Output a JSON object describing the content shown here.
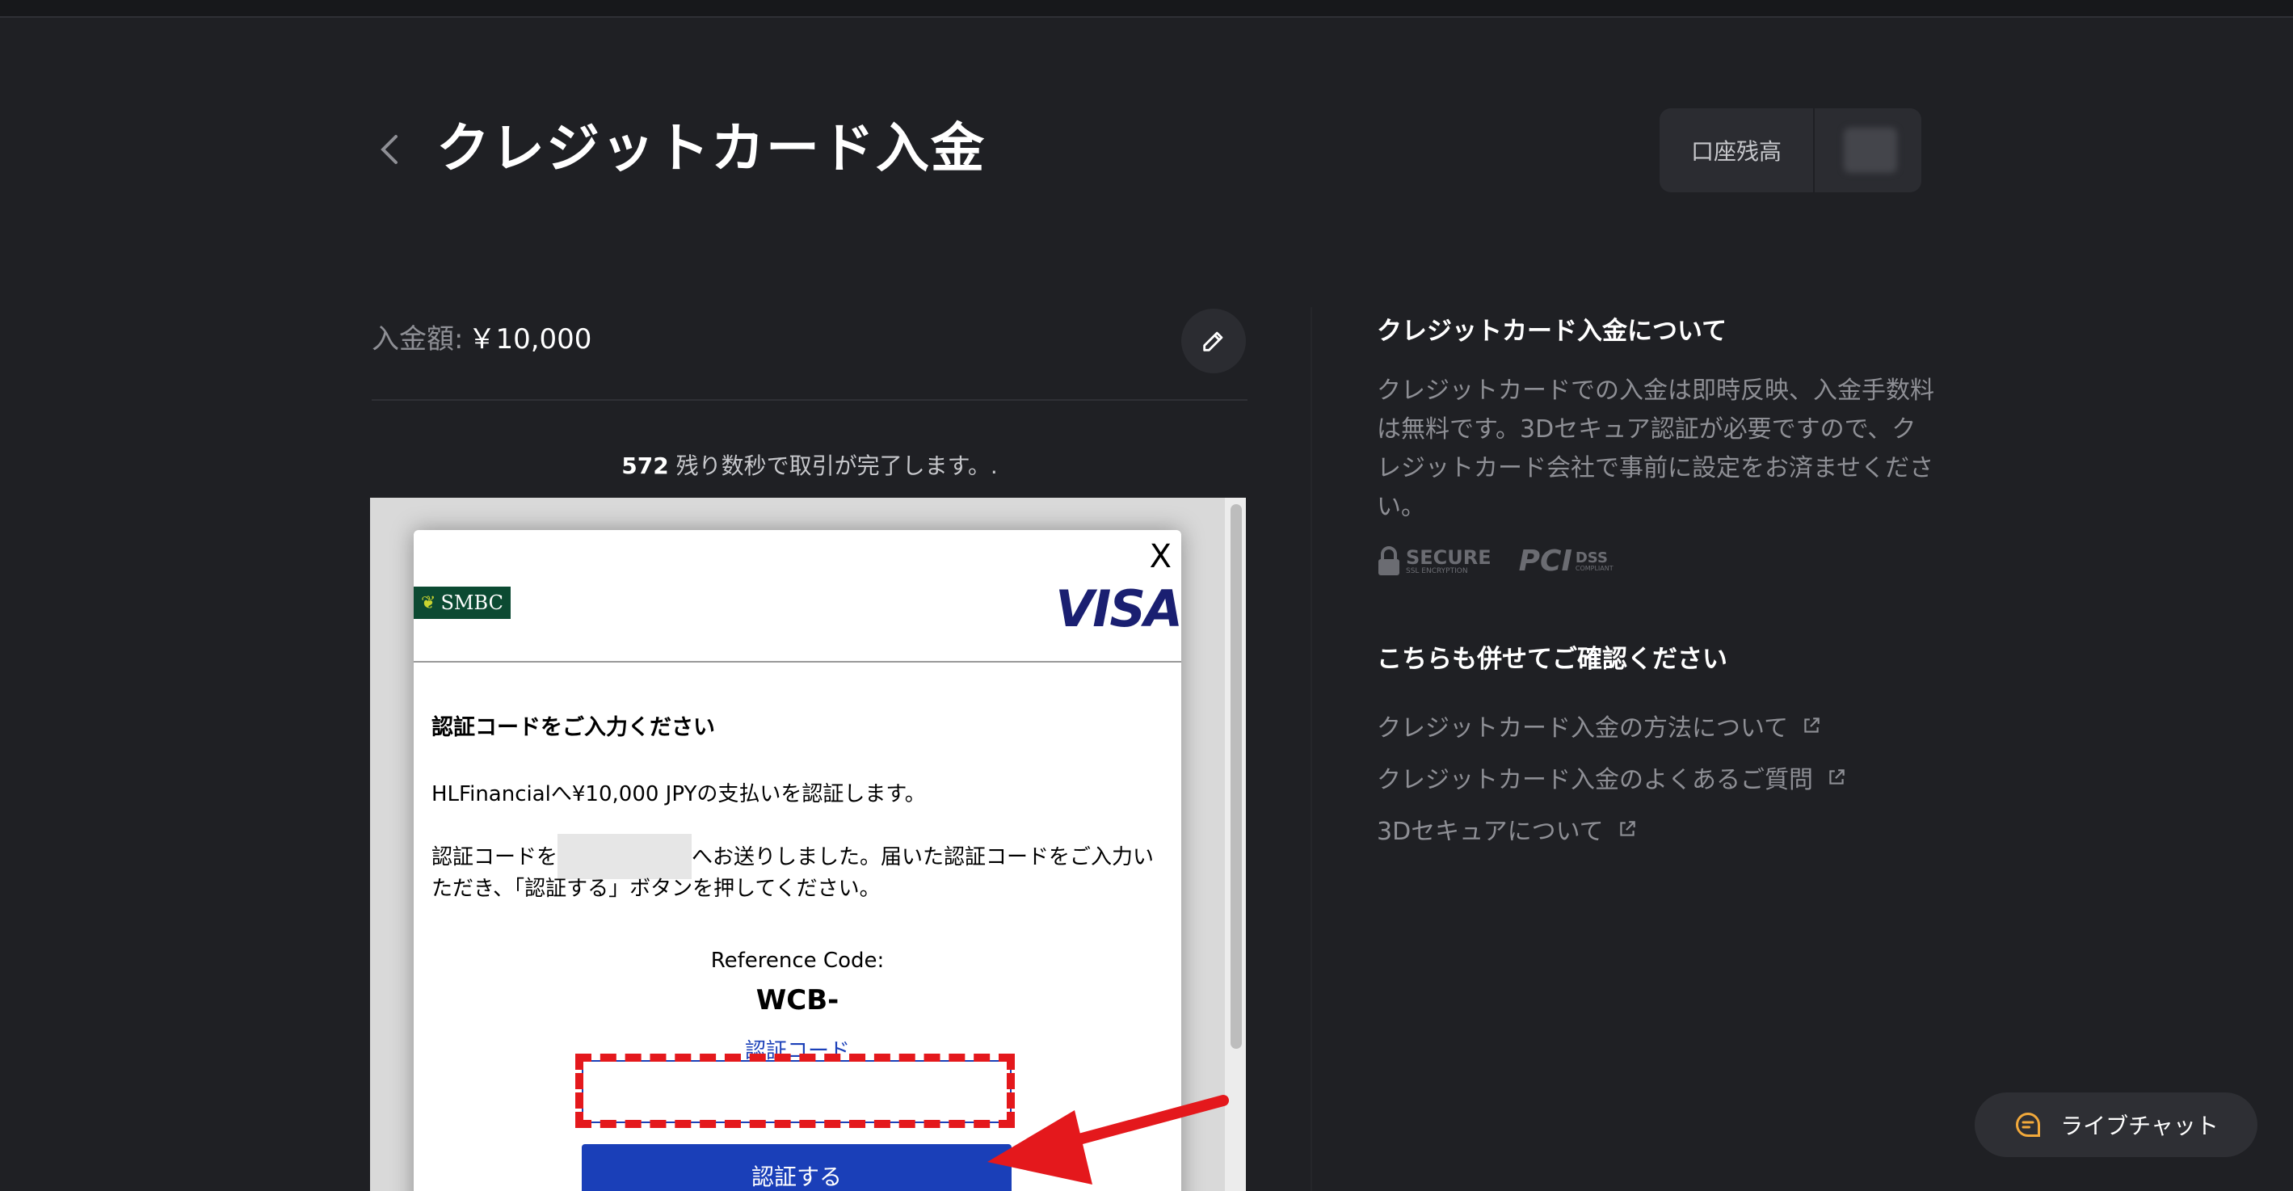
{
  "header": {
    "title": "クレジットカード入金",
    "balance_label": "口座残高"
  },
  "deposit": {
    "amount_label": "入金額:",
    "amount_value": "￥10,000",
    "countdown_seconds": "572",
    "countdown_text": " 残り数秒で取引が完了します。."
  },
  "auth_modal": {
    "close_label": "X",
    "bank_logo": "SMBC",
    "card_brand": "VISA",
    "heading": "認証コードをご入力ください",
    "payment_line": "HLFinancialへ¥10,000 JPYの支払いを認証します。",
    "sent_text_before": "認証コードを",
    "sent_text_after": "へお送りしました。届いた認証コードをご入力いただき、「認証する」ボタンを押してください。",
    "reference_label": "Reference Code:",
    "reference_code": "WCB-",
    "otp_label": "認証コード",
    "otp_value": "",
    "submit_label": "認証する"
  },
  "info": {
    "title": "クレジットカード入金について",
    "body": "クレジットカードでの入金は即時反映、入金手数料は無料です。3Dセキュア認証が必要ですので、クレジットカード会社で事前に設定をお済ませください。",
    "badge_secure_main": "SECURE",
    "badge_secure_sub": "SSL ENCRYPTION",
    "badge_pci_main": "PCI",
    "badge_pci_dss": "DSS",
    "badge_pci_sub": "COMPLIANT"
  },
  "related": {
    "title": "こちらも併せてご確認ください",
    "links": [
      {
        "label": "クレジットカード入金の方法について"
      },
      {
        "label": "クレジットカード入金のよくあるご質問"
      },
      {
        "label": "3Dセキュアについて"
      }
    ]
  },
  "chat": {
    "label": "ライブチャット"
  },
  "colors": {
    "background": "#1f2024",
    "panel": "#2b2c31",
    "muted_text": "#8e8f95",
    "visa_blue": "#1a1f71",
    "button_blue": "#1a3fb8",
    "annotation_red": "#e4181c",
    "smbc_green": "#0c4a32"
  }
}
